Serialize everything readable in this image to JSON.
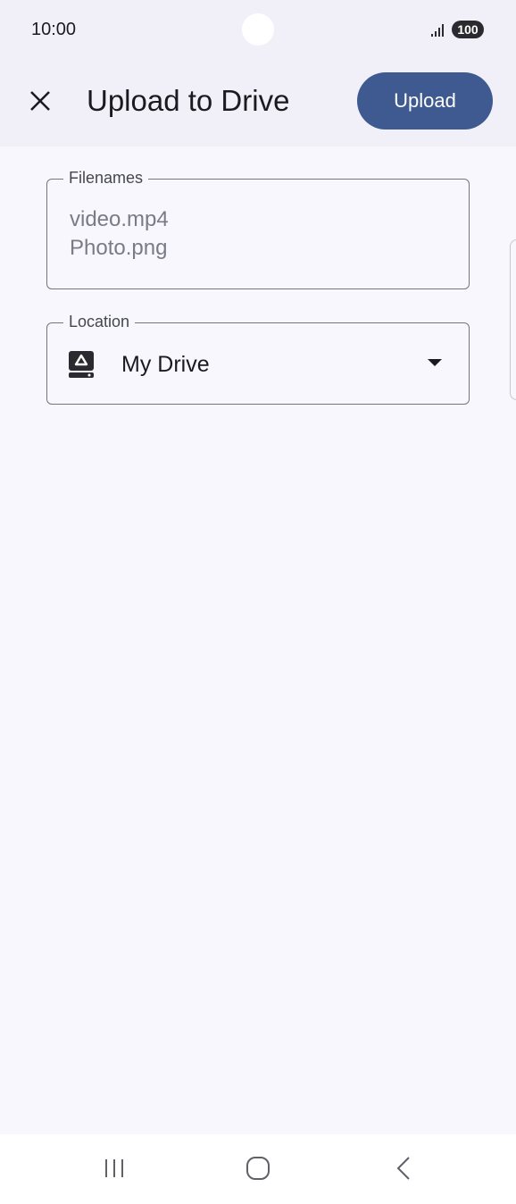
{
  "status_bar": {
    "time": "10:00",
    "battery": "100"
  },
  "app_bar": {
    "title": "Upload to Drive",
    "upload_label": "Upload"
  },
  "filenames": {
    "label": "Filenames",
    "values": [
      "video.mp4",
      "Photo.png"
    ]
  },
  "location": {
    "label": "Location",
    "value": "My Drive"
  },
  "colors": {
    "accent": "#3f5a90",
    "background": "#f8f7fd",
    "app_bar": "#f1f0f8"
  }
}
